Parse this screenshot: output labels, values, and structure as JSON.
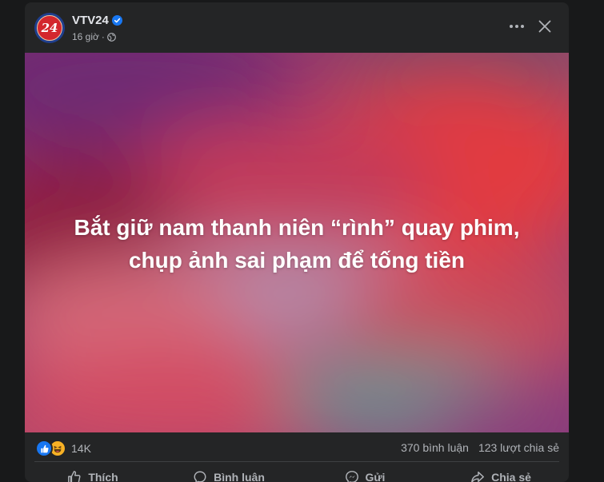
{
  "post": {
    "page_name": "VTV24",
    "avatar_text": "24",
    "time": "16 giờ",
    "separator": "·",
    "title_line1": "Bắt giữ nam thanh niên “rình” quay phim,",
    "title_line2": "chụp ảnh sai phạm để tống tiền"
  },
  "stats": {
    "reaction_count": "14K",
    "comments": "370 bình luận",
    "shares": "123 lượt chia sẻ"
  },
  "actions": {
    "like": "Thích",
    "comment": "Bình luận",
    "send": "Gửi",
    "share": "Chia sẻ"
  },
  "icons": {
    "verified": "verified-badge-icon",
    "globe": "globe-icon",
    "more": "more-horizontal-icon",
    "close": "close-icon"
  },
  "colors": {
    "card_bg": "#242526",
    "page_bg": "#18191a",
    "accent": "#1877f2",
    "text_secondary": "#b0b3b8"
  }
}
